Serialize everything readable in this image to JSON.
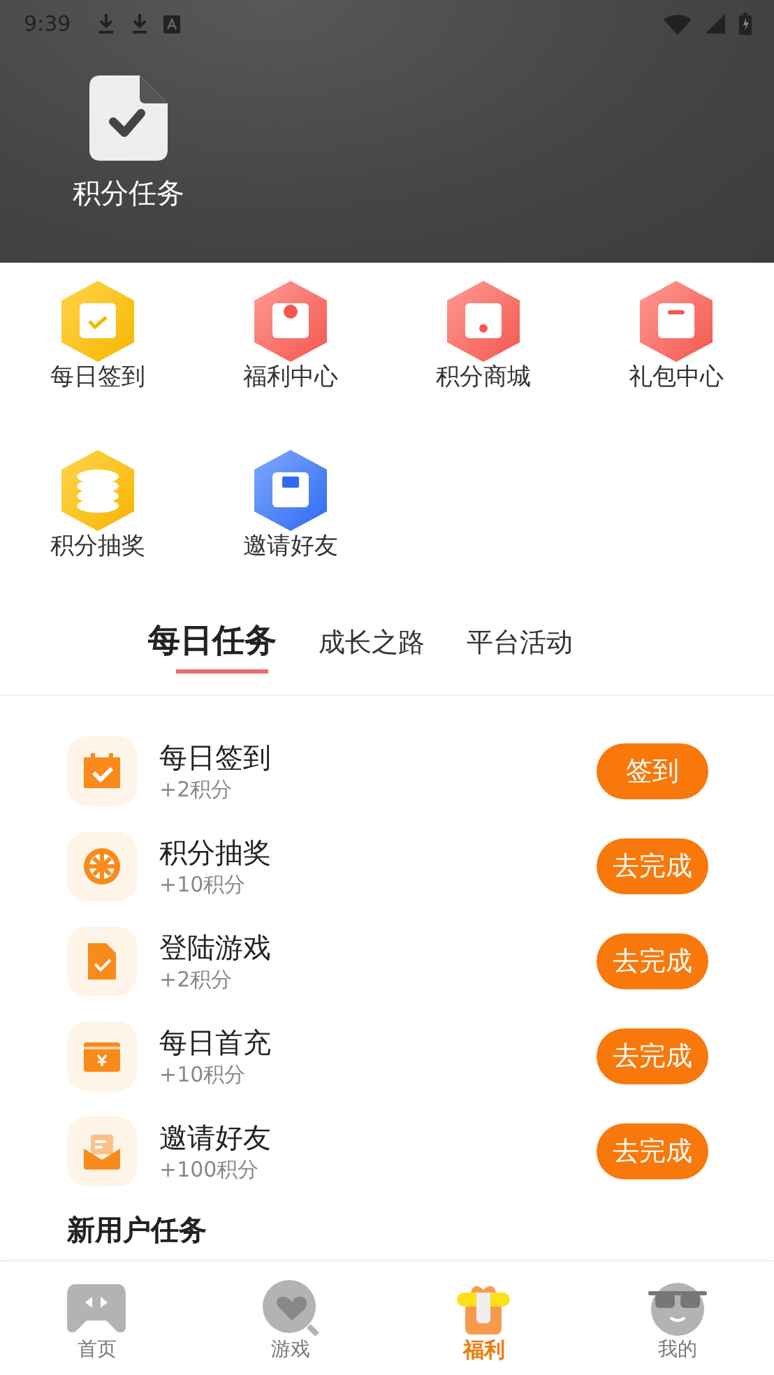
{
  "status_bar": {
    "time": "9:39"
  },
  "header": {
    "title": "积分任务"
  },
  "shortcuts": [
    {
      "label": "每日签到"
    },
    {
      "label": "福利中心"
    },
    {
      "label": "积分商城"
    },
    {
      "label": "礼包中心"
    },
    {
      "label": "积分抽奖"
    },
    {
      "label": "邀请好友"
    }
  ],
  "tabs": [
    {
      "label": "每日任务",
      "selected": true
    },
    {
      "label": "成长之路",
      "selected": false
    },
    {
      "label": "平台活动",
      "selected": false
    }
  ],
  "tasks": [
    {
      "title": "每日签到",
      "reward": "+2积分",
      "action": "签到"
    },
    {
      "title": "积分抽奖",
      "reward": "+10积分",
      "action": "去完成"
    },
    {
      "title": "登陆游戏",
      "reward": "+2积分",
      "action": "去完成"
    },
    {
      "title": "每日首充",
      "reward": "+10积分",
      "action": "去完成"
    },
    {
      "title": "邀请好友",
      "reward": "+100积分",
      "action": "去完成"
    }
  ],
  "section_heading": "新用户任务",
  "bottom_nav": [
    {
      "label": "首页",
      "selected": false
    },
    {
      "label": "游戏",
      "selected": false
    },
    {
      "label": "福利",
      "selected": true
    },
    {
      "label": "我的",
      "selected": false
    }
  ]
}
